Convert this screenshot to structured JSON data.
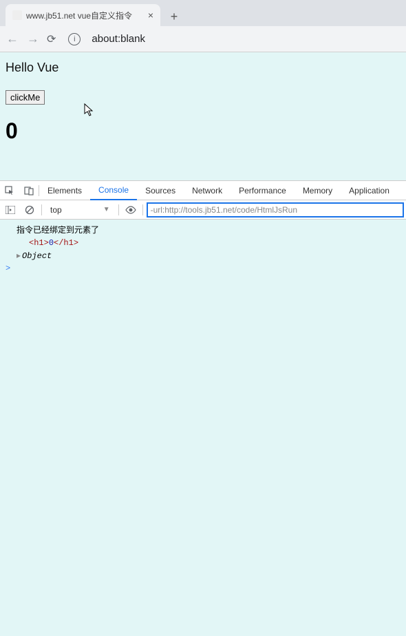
{
  "browser": {
    "tab_title": "www.jb51.net vue自定义指令",
    "url": "about:blank"
  },
  "page": {
    "heading": "Hello Vue",
    "button_label": "clickMe",
    "counter_value": "0"
  },
  "devtools": {
    "tabs": [
      "Elements",
      "Console",
      "Sources",
      "Network",
      "Performance",
      "Memory",
      "Application"
    ],
    "active_tab": "Console",
    "context": "top",
    "filter_value": "-url:http://tools.jb51.net/code/HtmlJsRun",
    "log_message": "指令已经绑定到元素了",
    "html_open": "<h1>",
    "html_text": "0",
    "html_close": "</h1>",
    "object_label": "Object",
    "prompt": ">"
  }
}
